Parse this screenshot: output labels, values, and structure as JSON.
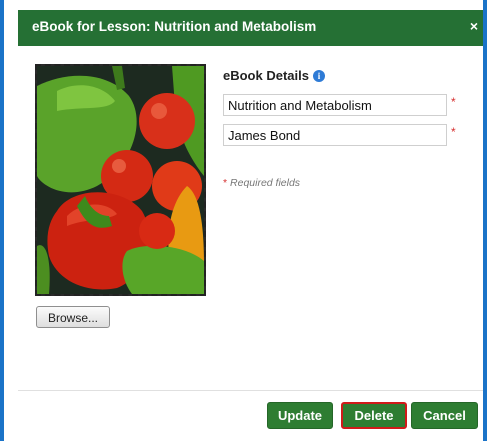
{
  "dialog": {
    "title": "eBook for Lesson: Nutrition and Metabolism",
    "close_glyph": "×"
  },
  "cover_image": {
    "icon": "vegetables-photo",
    "browse_label": "Browse..."
  },
  "details": {
    "heading": "eBook Details",
    "info_glyph": "i",
    "fields": [
      {
        "value": "Nutrition and Metabolism",
        "required_mark": "*"
      },
      {
        "value": "James Bond",
        "required_mark": "*"
      }
    ],
    "required_note_star": "*",
    "required_note_text": "Required fields"
  },
  "footer": {
    "update_label": "Update",
    "delete_label": "Delete",
    "cancel_label": "Cancel"
  },
  "colors": {
    "titlebar": "#257034",
    "button": "#2e7d32",
    "highlight_border": "#d01a1a",
    "window_frame": "#1a73c8",
    "required_star": "#d63030"
  }
}
